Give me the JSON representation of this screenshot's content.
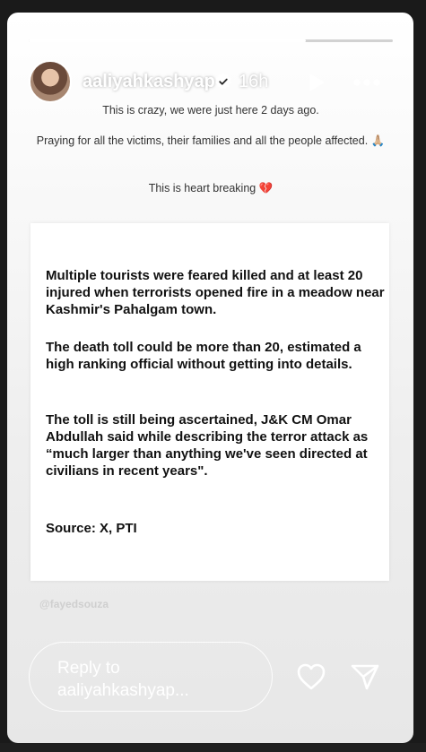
{
  "story": {
    "progress_fraction": 0.76,
    "username": "aaliyahkashyap",
    "time_ago": "16h",
    "caption": [
      "This is crazy, we were just here 2 days ago.",
      "Praying for all the victims, their families and all the people affected. 🙏🏼",
      "This is heart breaking 💔"
    ],
    "card_paragraphs": [
      "Multiple tourists were feared killed and at least 20 injured when terrorists opened fire in a meadow near Kashmir's Pahalgam town.",
      "The death toll could be more than 20, estimated a high ranking official without getting into details.",
      "The toll is still being ascertained, J&K CM Omar Abdullah said while describing the terror attack as “much larger than anything we've seen directed at civilians in recent years\".",
      "Source: X, PTI"
    ],
    "watermark": "@fayedsouza",
    "reply_placeholder": "Reply to aaliyahkashyap..."
  },
  "icons": {
    "verified": "verified-badge-icon",
    "play": "play-icon",
    "more": "more-options-icon",
    "like": "heart-icon",
    "share": "send-icon"
  },
  "colors": {
    "verified_blue": "#0095f6",
    "text_dark": "#111111"
  }
}
